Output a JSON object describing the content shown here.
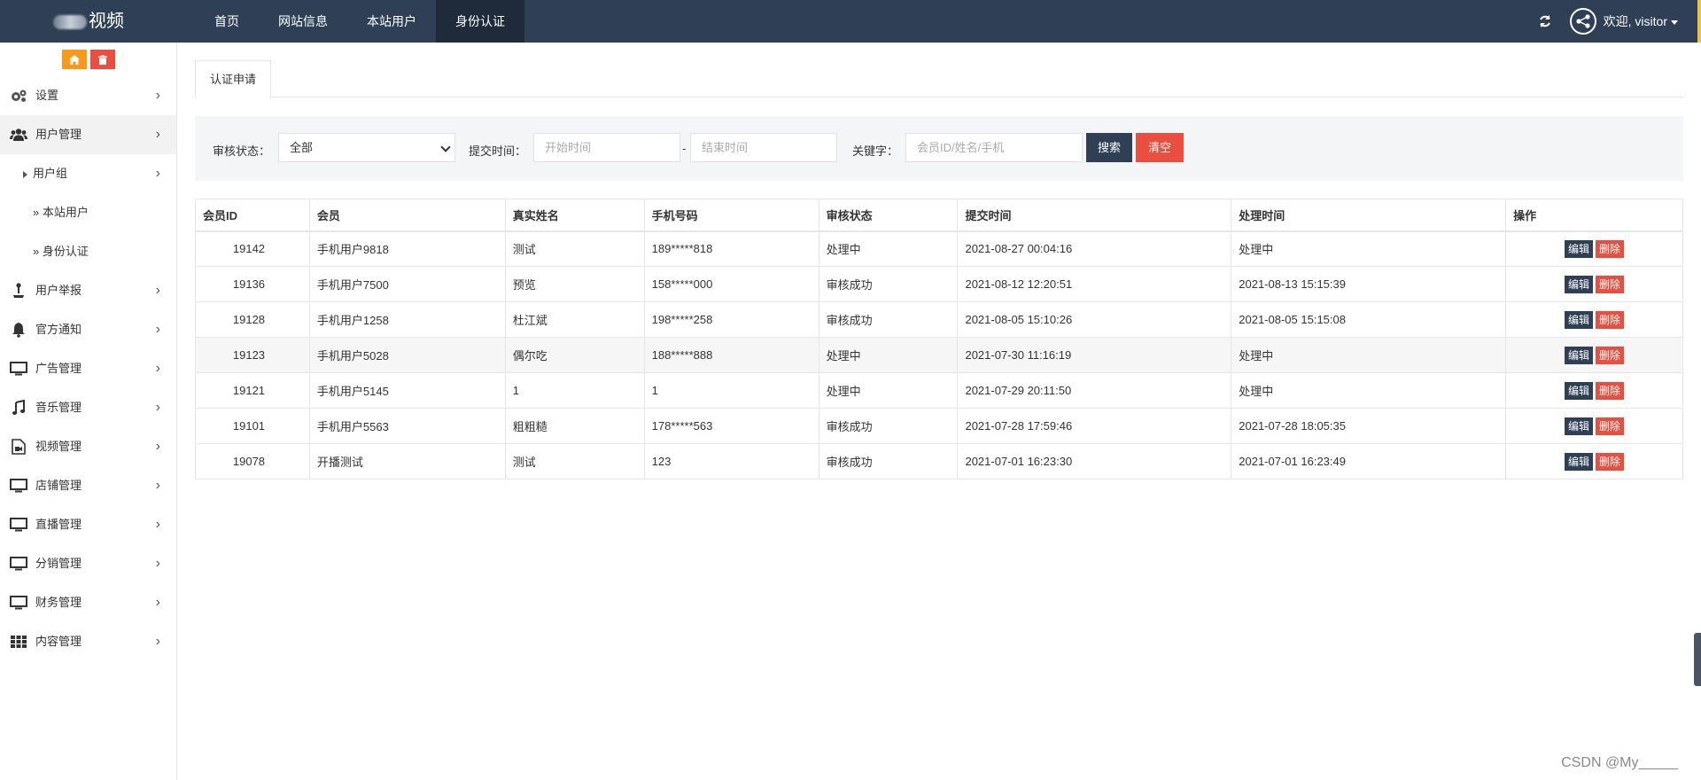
{
  "topbar": {
    "logo_text": "视频",
    "nav": [
      "首页",
      "网站信息",
      "本站用户",
      "身份认证"
    ],
    "welcome": "欢迎, visitor"
  },
  "sidebar": {
    "items": [
      {
        "label": "设置",
        "icon": "gears-icon"
      },
      {
        "label": "用户管理",
        "icon": "users-icon"
      },
      {
        "label": "用户组",
        "type": "sub"
      },
      {
        "label": "» 本站用户",
        "type": "leaf"
      },
      {
        "label": "» 身份认证",
        "type": "leaf"
      },
      {
        "label": "用户举报",
        "icon": "joystick-icon"
      },
      {
        "label": "官方通知",
        "icon": "bell-icon"
      },
      {
        "label": "广告管理",
        "icon": "monitor-icon"
      },
      {
        "label": "音乐管理",
        "icon": "music-icon"
      },
      {
        "label": "视频管理",
        "icon": "video-file-icon"
      },
      {
        "label": "店铺管理",
        "icon": "monitor-icon"
      },
      {
        "label": "直播管理",
        "icon": "monitor-icon"
      },
      {
        "label": "分销管理",
        "icon": "monitor-icon"
      },
      {
        "label": "财务管理",
        "icon": "monitor-icon"
      },
      {
        "label": "内容管理",
        "icon": "grid-icon"
      }
    ]
  },
  "tab": {
    "label": "认证申请"
  },
  "filter": {
    "status_label": "审核状态：",
    "status_value": "全部",
    "time_label": "提交时间：",
    "start_placeholder": "开始时间",
    "dash": "-",
    "end_placeholder": "结束时间",
    "keyword_label": "关键字：",
    "keyword_placeholder": "会员ID/姓名/手机",
    "search_btn": "搜索",
    "clear_btn": "清空"
  },
  "table": {
    "headers": [
      "会员ID",
      "会员",
      "真实姓名",
      "手机号码",
      "审核状态",
      "提交时间",
      "处理时间",
      "操作"
    ],
    "edit_label": "编辑",
    "delete_label": "删除",
    "rows": [
      [
        "19142",
        "手机用户9818",
        "测试",
        "189*****818",
        "处理中",
        "2021-08-27 00:04:16",
        "处理中"
      ],
      [
        "19136",
        "手机用户7500",
        "预览",
        "158*****000",
        "审核成功",
        "2021-08-12 12:20:51",
        "2021-08-13 15:15:39"
      ],
      [
        "19128",
        "手机用户1258",
        "杜江斌",
        "198*****258",
        "审核成功",
        "2021-08-05 15:10:26",
        "2021-08-05 15:15:08"
      ],
      [
        "19123",
        "手机用户5028",
        "偶尔吃",
        "188*****888",
        "处理中",
        "2021-07-30 11:16:19",
        "处理中"
      ],
      [
        "19121",
        "手机用户5145",
        "1",
        "1",
        "处理中",
        "2021-07-29 20:11:50",
        "处理中"
      ],
      [
        "19101",
        "手机用户5563",
        "粗粗糙",
        "178*****563",
        "审核成功",
        "2021-07-28 17:59:46",
        "2021-07-28 18:05:35"
      ],
      [
        "19078",
        "开播测试",
        "测试",
        "123",
        "审核成功",
        "2021-07-01 16:23:30",
        "2021-07-01 16:23:49"
      ]
    ]
  },
  "watermark": "CSDN @My_____"
}
